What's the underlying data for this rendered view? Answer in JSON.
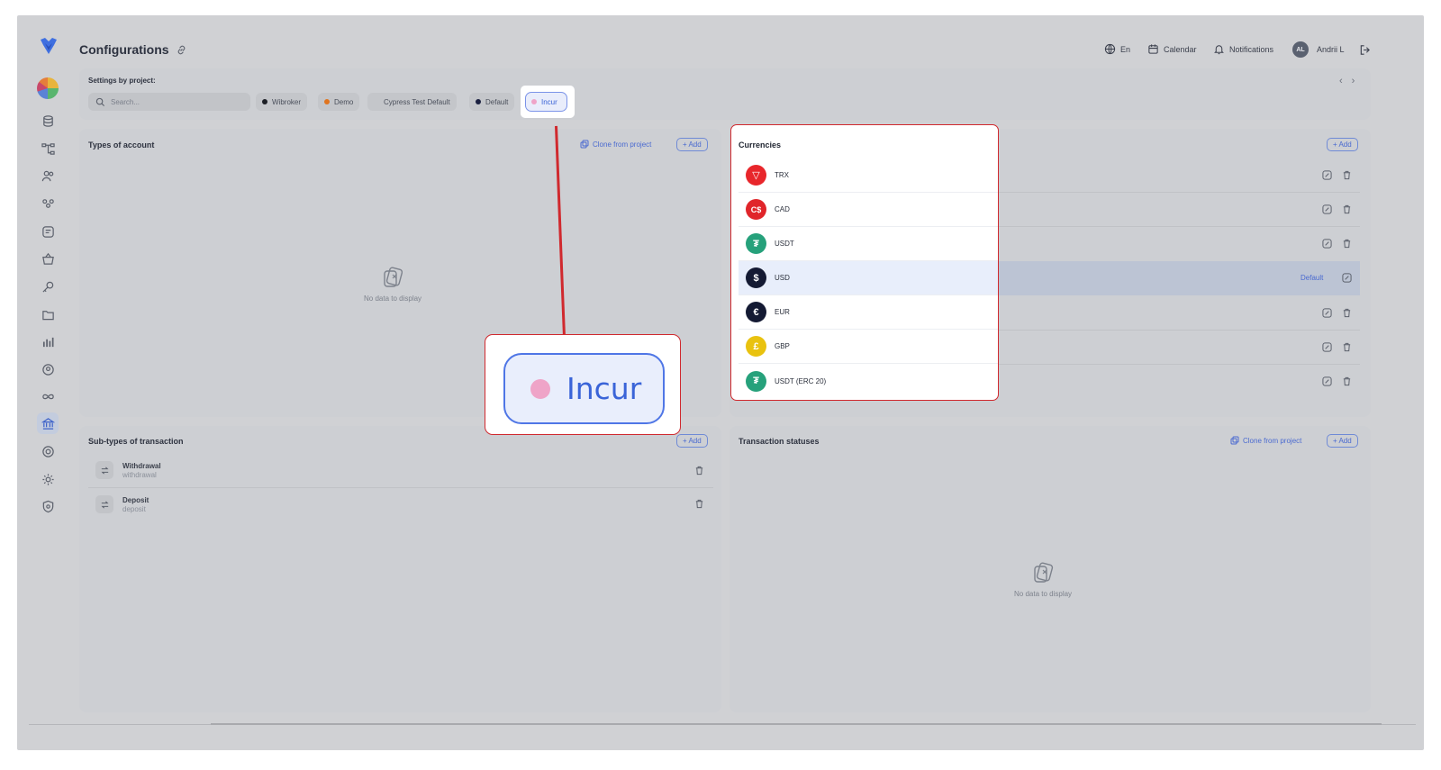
{
  "header": {
    "title": "Configurations",
    "language": "En",
    "calendar": "Calendar",
    "notifications": "Notifications",
    "user_initials": "AL",
    "user_name": "Andrii L"
  },
  "projects": {
    "label": "Settings by project:",
    "search_placeholder": "Search...",
    "chips": [
      {
        "label": "Wibroker",
        "color": "#1c1f26"
      },
      {
        "label": "Demo",
        "color": "#e0741f"
      },
      {
        "label": "Cypress Test Default",
        "color": ""
      },
      {
        "label": "Default",
        "color": "#1a2040"
      },
      {
        "label": "Incur",
        "color": "#efa4c8"
      }
    ],
    "selected": "Incur"
  },
  "types_of_account": {
    "title": "Types of account",
    "clone": "Clone from project",
    "add": "+ Add",
    "empty": "No data to display"
  },
  "currencies": {
    "title": "Currencies",
    "add": "+ Add",
    "default_label": "Default",
    "items": [
      {
        "code": "TRX",
        "symbol": "▽",
        "color": "#e8262b"
      },
      {
        "code": "CAD",
        "symbol": "C$",
        "color": "#e0252a"
      },
      {
        "code": "USDT",
        "symbol": "₮",
        "color": "#26a17b"
      },
      {
        "code": "USD",
        "symbol": "$",
        "color": "#141a33"
      },
      {
        "code": "EUR",
        "symbol": "€",
        "color": "#141a33"
      },
      {
        "code": "GBP",
        "symbol": "£",
        "color": "#e9c20f"
      },
      {
        "code": "USDT (ERC 20)",
        "symbol": "₮",
        "color": "#26a17b"
      }
    ]
  },
  "subtypes": {
    "title": "Sub-types of transaction",
    "add": "+ Add",
    "items": [
      {
        "name": "Withdrawal",
        "slug": "withdrawal"
      },
      {
        "name": "Deposit",
        "slug": "deposit"
      }
    ]
  },
  "statuses": {
    "title": "Transaction statuses",
    "clone": "Clone from project",
    "add": "+ Add",
    "empty": "No data to display"
  },
  "callout": {
    "label": "Incur"
  },
  "colors": {
    "accent": "#4a6ad0",
    "highlight": "#d0292e"
  }
}
